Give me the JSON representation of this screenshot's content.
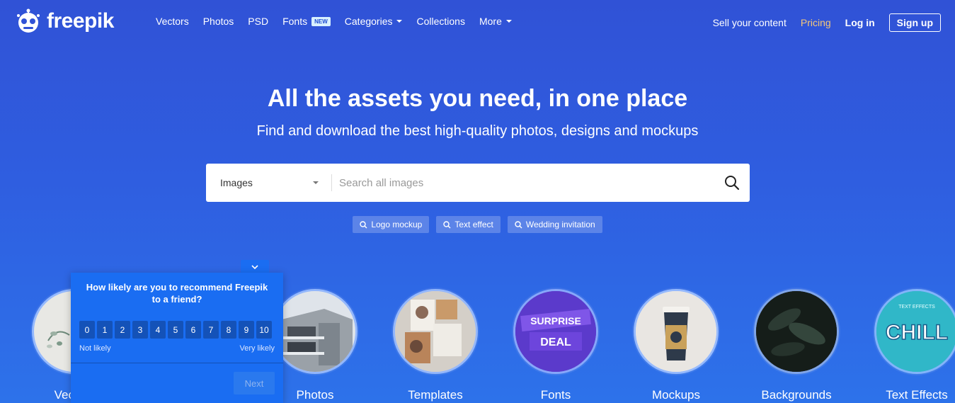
{
  "brand": {
    "name": "freepik"
  },
  "nav": {
    "items": [
      {
        "label": "Vectors"
      },
      {
        "label": "Photos"
      },
      {
        "label": "PSD"
      },
      {
        "label": "Fonts",
        "badge": "NEW"
      },
      {
        "label": "Categories"
      },
      {
        "label": "Collections"
      },
      {
        "label": "More"
      }
    ],
    "sell": "Sell your content",
    "pricing": "Pricing",
    "login": "Log in",
    "signup": "Sign up"
  },
  "hero": {
    "title": "All the assets you need, in one place",
    "subtitle": "Find and download the best high-quality photos, designs and mockups"
  },
  "search": {
    "type": "Images",
    "placeholder": "Search all images",
    "tags": [
      "Logo mockup",
      "Text effect",
      "Wedding invitation"
    ]
  },
  "categories": [
    {
      "label": "Vectors"
    },
    {
      "label": "Photos"
    },
    {
      "label": "Templates"
    },
    {
      "label": "Fonts",
      "art_text": [
        "SURPRISE",
        "DEAL"
      ]
    },
    {
      "label": "Mockups"
    },
    {
      "label": "Backgrounds"
    },
    {
      "label": "Text Effects",
      "art_text": [
        "TEXT EFFECTS",
        "CHILL"
      ]
    }
  ],
  "survey": {
    "question": "How likely are you to recommend Freepik to a friend?",
    "scale": [
      "0",
      "1",
      "2",
      "3",
      "4",
      "5",
      "6",
      "7",
      "8",
      "9",
      "10"
    ],
    "low_label": "Not likely",
    "high_label": "Very likely",
    "next": "Next"
  },
  "colors": {
    "background": "#3052d6",
    "pricing": "#f4c77a",
    "survey": "#1a6df2"
  }
}
